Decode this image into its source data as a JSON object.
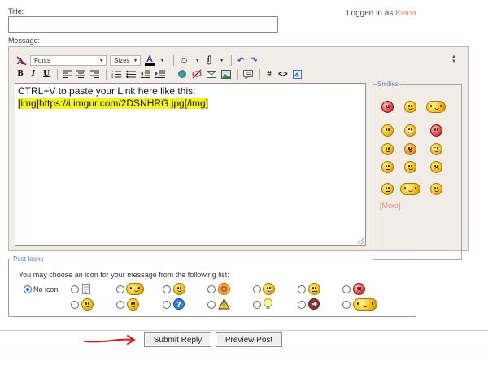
{
  "form": {
    "title_label": "Title:",
    "title_value": "",
    "logged_in_prefix": "Logged in as",
    "username": "Kiana",
    "message_label": "Message:"
  },
  "toolbar": {
    "font_select": "Fonts",
    "size_select": "Sizes",
    "bold": "B",
    "italic": "I",
    "underline": "U",
    "hash": "#",
    "code": "<>"
  },
  "message": {
    "line1": "CTRL+V to paste your Link here like this:",
    "line2": "[img]https://i.imgur.com/2DSNHRG.jpg[/img]"
  },
  "smilies": {
    "legend": "Smilies",
    "more_link": "[More]"
  },
  "post_icons": {
    "legend": "Post Icons",
    "instruction": "You may choose an icon for your message from the following list:",
    "no_icon_label": "No icon",
    "selected": "no-icon"
  },
  "buttons": {
    "submit": "Submit Reply",
    "preview": "Preview Post"
  },
  "colors": {
    "accent_link": "#e98b8b",
    "legend_blue": "#5b7fc3",
    "highlight": "#f7f71e",
    "arrow_red": "#d01c1c"
  }
}
